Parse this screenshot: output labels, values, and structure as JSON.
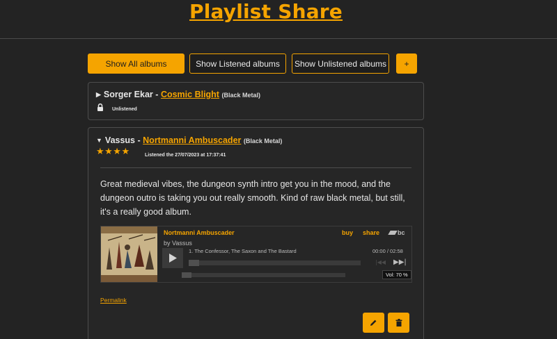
{
  "site": {
    "title": "Playlist Share"
  },
  "filters": {
    "all": "Show All albums",
    "listened": "Show Listened albums",
    "unlistened": "Show Unlistened albums",
    "add": "+"
  },
  "albums": [
    {
      "artist": "Sorger Ekar",
      "separator": "-",
      "title": "Cosmic Blight",
      "genre": "(Black Metal)",
      "status": "Unlistened",
      "status_icon": "lock-icon"
    },
    {
      "artist": "Vassus",
      "separator": "-",
      "title": "Nortmanni Ambuscader",
      "genre": "(Black Metal)",
      "rating": 4,
      "rating_max": 4,
      "stars": "★★★★",
      "listened_text": "Listened the 27/07/2023 at 17:37:41",
      "review": "Great medieval vibes, the dungeon synth intro get you in the mood, and the dungeon outro is taking you out really smooth. Kind of raw black metal, but still, it's a really good album.",
      "player": {
        "album": "Nortmanni Ambuscader",
        "by": "by Vassus",
        "buy": "buy",
        "share": "share",
        "brand": "bc",
        "track": "1.   The Confessor, The Saxon and The Bastard",
        "time": "00:00 / 02:58",
        "progress": 0,
        "volume_label": "Vol: 70 %",
        "volume": 0.7
      },
      "permalink": "Permalink"
    }
  ],
  "colors": {
    "accent": "#f5a400",
    "background": "#232323",
    "card": "#262626",
    "border": "#4d4d4d"
  }
}
